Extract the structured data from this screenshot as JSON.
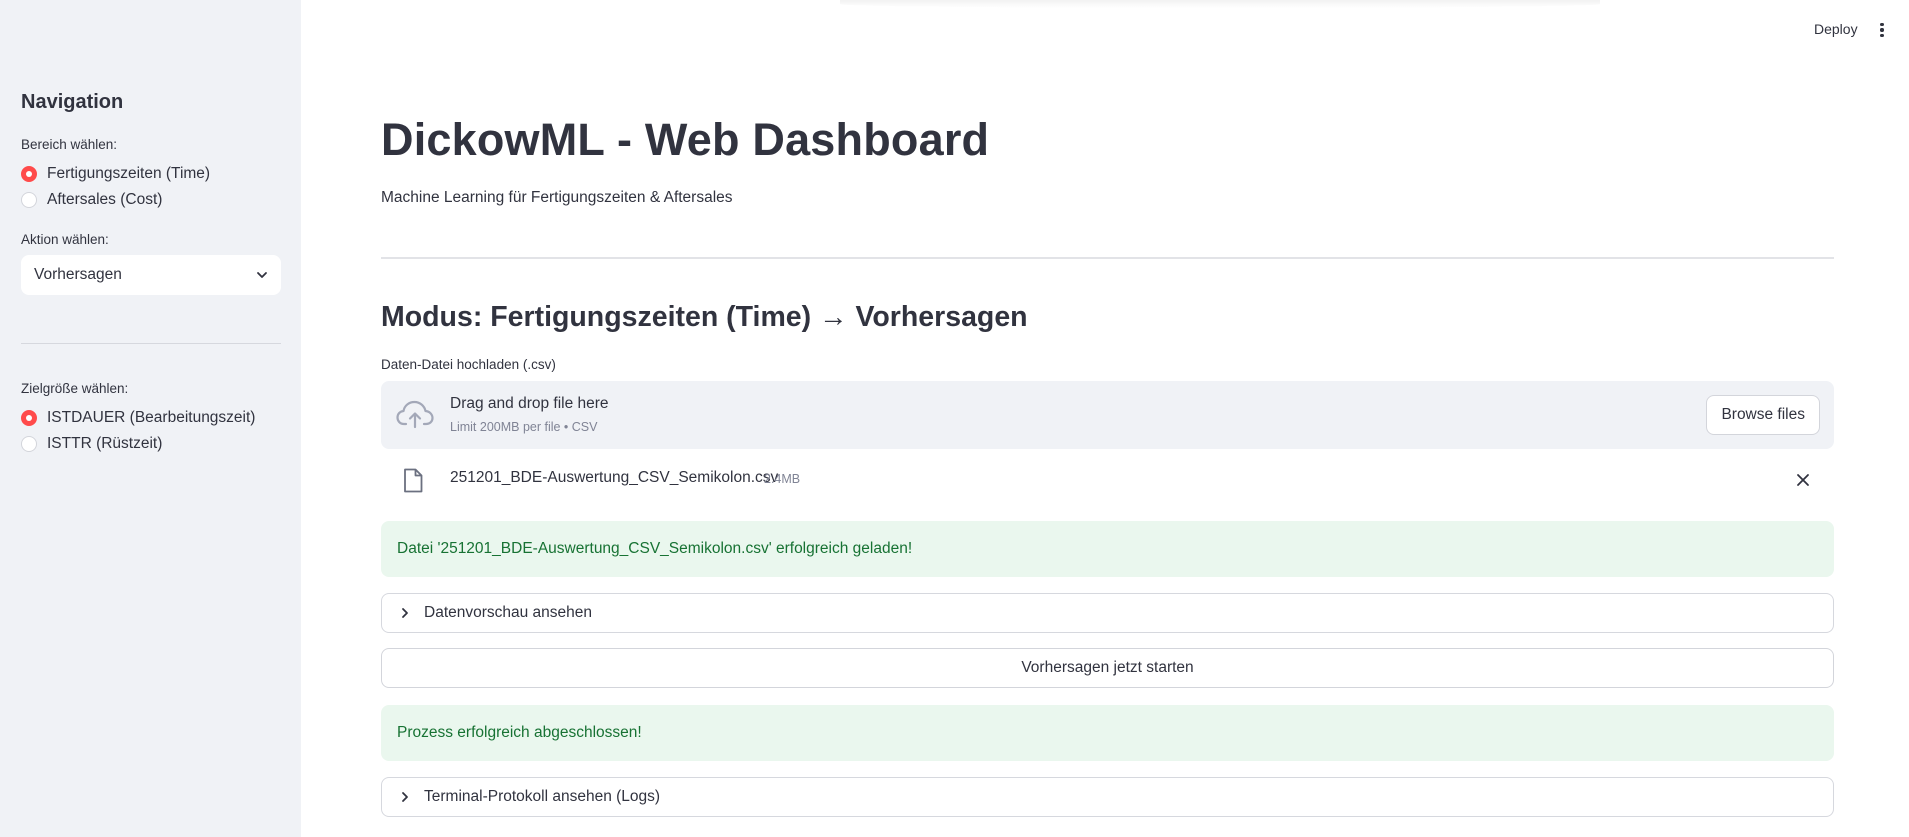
{
  "topbar": {
    "deploy_label": "Deploy"
  },
  "sidebar": {
    "heading": "Navigation",
    "area_label": "Bereich wählen:",
    "area_options": [
      {
        "label": "Fertigungszeiten (Time)",
        "selected": true
      },
      {
        "label": "Aftersales (Cost)",
        "selected": false
      }
    ],
    "action_label": "Aktion wählen:",
    "action_value": "Vorhersagen",
    "target_label": "Zielgröße wählen:",
    "target_options": [
      {
        "label": "ISTDAUER (Bearbeitungszeit)",
        "selected": true
      },
      {
        "label": "ISTTR (Rüstzeit)",
        "selected": false
      }
    ]
  },
  "main": {
    "title": "DickowML - Web Dashboard",
    "subtitle": "Machine Learning für Fertigungszeiten & Aftersales",
    "section_title": "Modus: Fertigungszeiten (Time) → Vorhersagen",
    "upload": {
      "label": "Daten-Datei hochladen (.csv)",
      "drop_title": "Drag and drop file here",
      "drop_limit": "Limit 200MB per file • CSV",
      "browse_label": "Browse files",
      "file_name": "251201_BDE-Auswertung_CSV_Semikolon.csv",
      "file_size": "2.4MB"
    },
    "load_success": "Datei '251201_BDE-Auswertung_CSV_Semikolon.csv' erfolgreich geladen!",
    "preview_expander": "Datenvorschau ansehen",
    "run_button": "Vorhersagen jetzt starten",
    "process_success": "Prozess erfolgreich abgeschlossen!",
    "logs_expander": "Terminal-Protokoll ansehen (Logs)"
  },
  "colors": {
    "accent": "#ff4b4b",
    "sidebar_bg": "#f0f2f6",
    "success_bg": "#eaf7ee",
    "success_text": "#177233",
    "text": "#31333f"
  }
}
